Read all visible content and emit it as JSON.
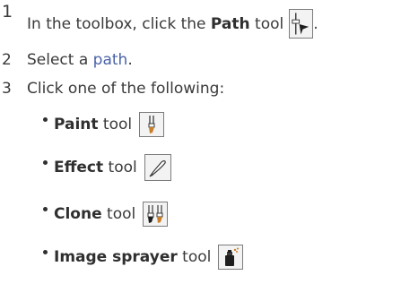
{
  "steps": [
    {
      "number": "1",
      "pre": "In the toolbox, click the ",
      "bold": "Path",
      "post": " tool",
      "icon": "path-tool-icon",
      "trail": "."
    },
    {
      "number": "2",
      "pre": "Select a ",
      "link": "path",
      "post": "."
    },
    {
      "number": "3",
      "text": "Click one of the following:"
    }
  ],
  "options": [
    {
      "bold": "Paint",
      "post": " tool",
      "icon": "paint-tool-icon"
    },
    {
      "bold": "Effect",
      "post": " tool",
      "icon": "effect-tool-icon"
    },
    {
      "bold": "Clone",
      "post": " tool",
      "icon": "clone-tool-icon"
    },
    {
      "bold": "Image sprayer",
      "post": " tool",
      "icon": "image-sprayer-tool-icon"
    }
  ],
  "colors": {
    "text": "#3a3a3a",
    "link": "#4a62a8",
    "icon_border": "#7c7c7c"
  }
}
